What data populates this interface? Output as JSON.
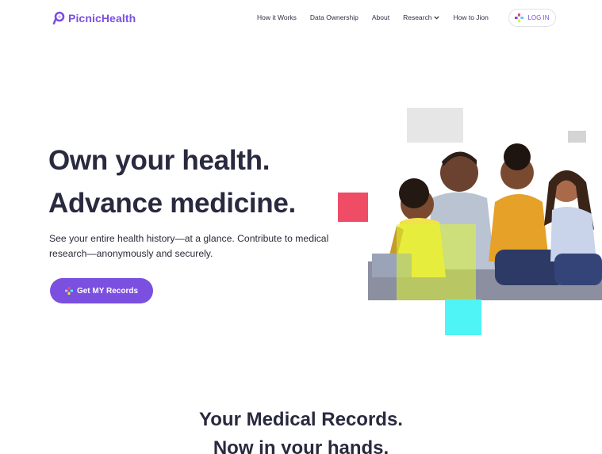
{
  "header": {
    "logo_text": "PicnicHealth",
    "nav": {
      "how_it_works": "How it Works",
      "data_ownership": "Data Ownership",
      "about": "About",
      "research": "Research",
      "how_to_join": "How to Jion"
    },
    "login_label": "LOG IN"
  },
  "hero": {
    "headline_line1": "Own your health.",
    "headline_line2": "Advance medicine.",
    "subtitle": "See your entire health history—at a glance. Contribute to medical research—anonymously and securely.",
    "cta_label": "Get MY Records"
  },
  "section2": {
    "title_line1": "Your Medical Records.",
    "title_line2": "Now in your hands."
  },
  "colors": {
    "brand_purple": "#7b4fe0",
    "accent_red": "#ef4c66",
    "accent_cyan": "#4ff4f6",
    "accent_yellow": "#def532",
    "heading": "#29293f"
  },
  "icons": {
    "logo": "picnichealth-logo-icon",
    "login": "multicolor-plus-icon",
    "cta": "multicolor-plus-icon",
    "research_dropdown": "chevron-down-icon"
  }
}
